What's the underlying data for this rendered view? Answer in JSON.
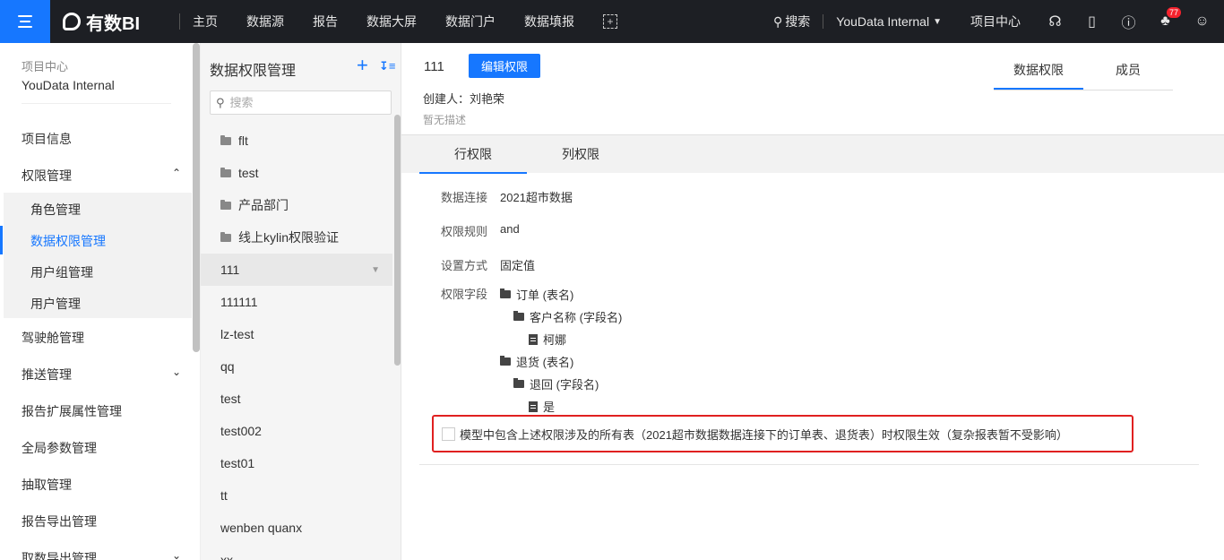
{
  "topbar": {
    "logo_text": "有数BI",
    "nav": [
      "主页",
      "数据源",
      "报告",
      "数据大屏",
      "数据门户",
      "数据填报"
    ],
    "search_label": "搜索",
    "workspace": "YouData Internal",
    "project_center": "项目中心",
    "notification_count": "77"
  },
  "sidebar": {
    "header_title": "项目中心",
    "header_project": "YouData Internal",
    "items": [
      "项目信息",
      "权限管理",
      "驾驶舱管理",
      "推送管理",
      "报告扩展属性管理",
      "全局参数管理",
      "抽取管理",
      "报告导出管理",
      "取数导出管理"
    ],
    "sub_items": [
      "角色管理",
      "数据权限管理",
      "用户组管理",
      "用户管理"
    ]
  },
  "list_panel": {
    "title": "数据权限管理",
    "search_placeholder": "搜索",
    "folders": [
      "flt",
      "test",
      "产品部门",
      "线上kylin权限验证"
    ],
    "items": [
      "111",
      "111111",
      "lz-test",
      "qq",
      "test",
      "test002",
      "test01",
      "tt",
      "wenben quanx",
      "xx"
    ]
  },
  "main": {
    "name": "111",
    "edit_button": "编辑权限",
    "creator": "创建人：刘艳荣",
    "description": "暂无描述",
    "tabs": [
      "数据权限",
      "成员"
    ],
    "subtabs": [
      "行权限",
      "列权限"
    ],
    "fields": {
      "connection_label": "数据连接",
      "connection_value": "2021超市数据",
      "rule_label": "权限规则",
      "rule_value": "and",
      "method_label": "设置方式",
      "method_value": "固定值",
      "field_label": "权限字段"
    },
    "tree": {
      "t1": "订单 (表名)",
      "t1_field": "客户名称 (字段名)",
      "t1_value": "柯娜",
      "t2": "退货 (表名)",
      "t2_field": "退回 (字段名)",
      "t2_value": "是"
    },
    "checkbox_label": "模型中包含上述权限涉及的所有表（2021超市数据数据连接下的订单表、退货表）时权限生效（复杂报表暂不受影响）"
  },
  "colors": {
    "accent": "#1677ff",
    "topbar": "#1d1f24",
    "highlight_border": "#e02020"
  }
}
